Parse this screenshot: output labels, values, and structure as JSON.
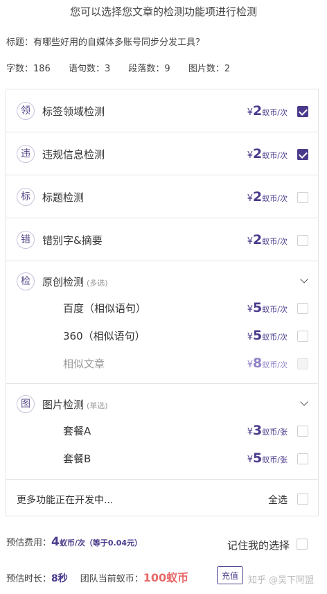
{
  "header": {
    "title": "您可以选择您文章的检测功能项进行检测"
  },
  "article": {
    "title_line": "标题：有哪些好用的自媒体多账号同步分发工具？",
    "stats": [
      "字数：186",
      "语句数：3",
      "段落数：9",
      "图片数：2"
    ]
  },
  "checks": [
    {
      "icon": "领",
      "label": "标签领域检测",
      "yen": "¥",
      "price": "2",
      "unit": "蚁币/次",
      "checked": true
    },
    {
      "icon": "违",
      "label": "违规信息检测",
      "yen": "¥",
      "price": "2",
      "unit": "蚁币/次",
      "checked": true
    },
    {
      "icon": "标",
      "label": "标题检测",
      "yen": "¥",
      "price": "2",
      "unit": "蚁币/次",
      "checked": false
    },
    {
      "icon": "错",
      "label": "错别字&摘要",
      "yen": "¥",
      "price": "2",
      "unit": "蚁币/次",
      "checked": false
    }
  ],
  "original": {
    "icon": "检",
    "label": "原创检测",
    "tag": "(多选)",
    "items": [
      {
        "label": "百度（相似语句）",
        "yen": "¥",
        "price": "5",
        "unit": "蚁币/次"
      },
      {
        "label": "360（相似语句）",
        "yen": "¥",
        "price": "5",
        "unit": "蚁币/次"
      },
      {
        "label": "相似文章",
        "yen": "¥",
        "price": "8",
        "unit": "蚁币/次"
      }
    ]
  },
  "image": {
    "icon": "图",
    "label": "图片检测",
    "tag": "(单选)",
    "items": [
      {
        "label": "套餐A",
        "yen": "¥",
        "price": "3",
        "unit": "蚁币/张"
      },
      {
        "label": "套餐B",
        "yen": "¥",
        "price": "5",
        "unit": "蚁币/张"
      }
    ]
  },
  "more": {
    "label": "更多功能正在开发中...",
    "select_all": "全选"
  },
  "footer": {
    "cost_label": "预估费用：",
    "cost_value": "4",
    "cost_unit": "蚁币/次",
    "cost_eq": "（等于0.04元）",
    "remember": "记住我的选择",
    "time_label": "预估时长：",
    "time_value": "8秒",
    "coins_label": "团队当前蚁币：",
    "coins_value": "100蚁币",
    "recharge": "充值",
    "watermark": "知乎 @吴下阿盟"
  },
  "colors": {
    "accent": "#4b3a8c",
    "coins": "#e86a6a"
  }
}
